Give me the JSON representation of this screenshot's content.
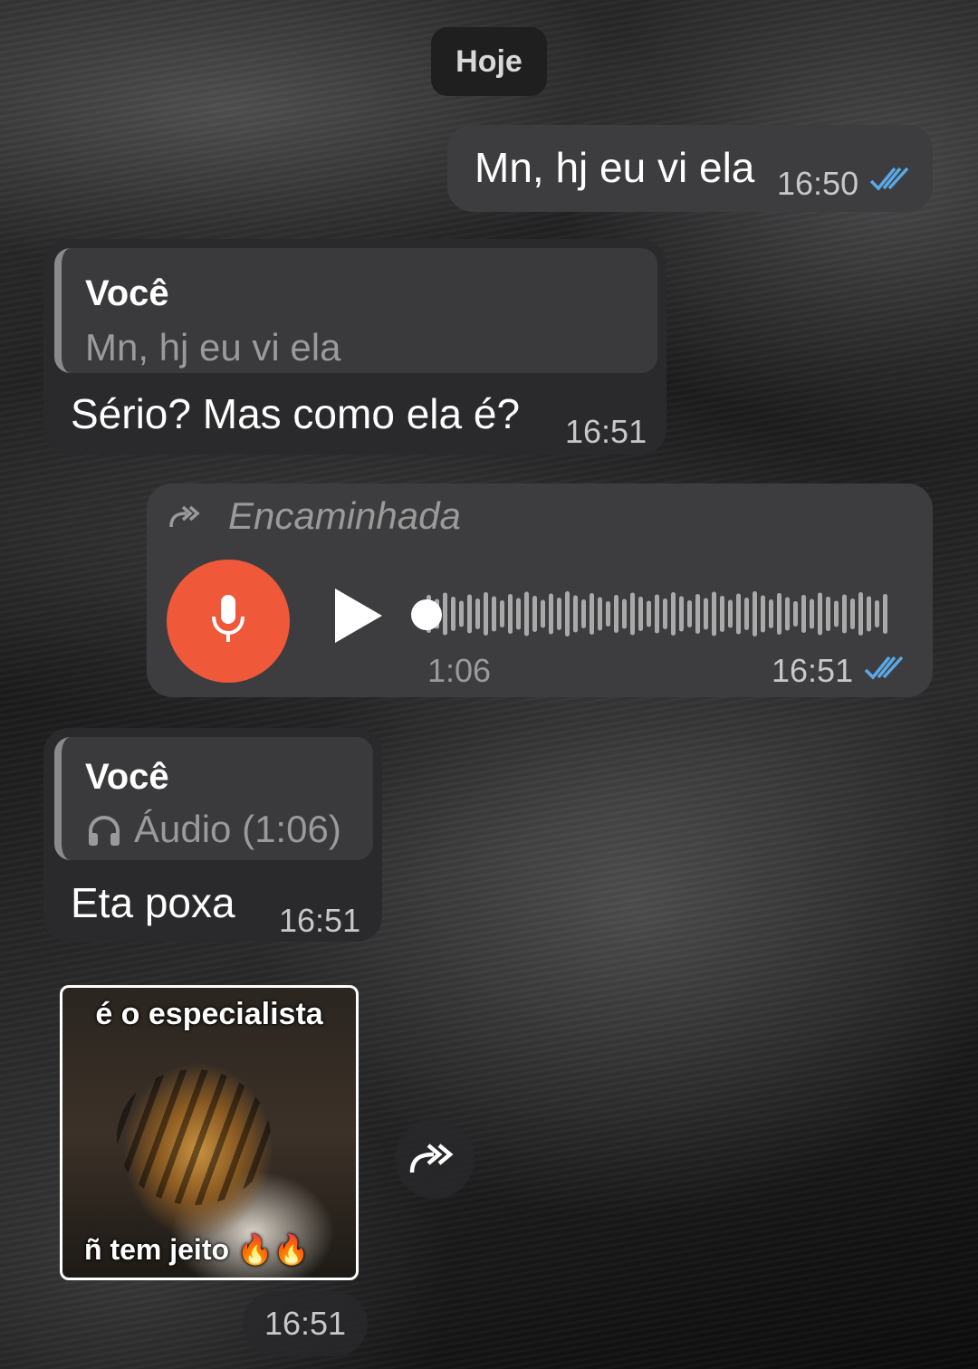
{
  "date_chip": "Hoje",
  "messages": [
    {
      "type": "outgoing-text",
      "text": "Mn, hj eu vi ela",
      "time": "16:50",
      "status": "read"
    },
    {
      "type": "incoming-reply",
      "reply_to": {
        "name": "Você",
        "preview": "Mn, hj eu vi ela"
      },
      "text": "Sério? Mas como ela é?",
      "time": "16:51"
    },
    {
      "type": "outgoing-voice",
      "forwarded_label": "Encaminhada",
      "duration": "1:06",
      "time": "16:51",
      "status": "read",
      "progress": 0
    },
    {
      "type": "incoming-reply",
      "reply_to": {
        "name": "Você",
        "preview": "Áudio (1:06)",
        "preview_icon": "headphones-icon"
      },
      "text": "Eta poxa",
      "time": "16:51"
    },
    {
      "type": "incoming-sticker",
      "caption_top": "é o especialista",
      "caption_bottom": "ñ tem jeito 🔥🔥",
      "time": "16:51"
    }
  ],
  "colors": {
    "mic_button": "#f0583a",
    "read_ticks": "#5aa9e6"
  },
  "icons": [
    "double-check-icon",
    "forward-icon",
    "mic-icon",
    "play-icon",
    "headphones-icon",
    "share-forward-icon"
  ]
}
